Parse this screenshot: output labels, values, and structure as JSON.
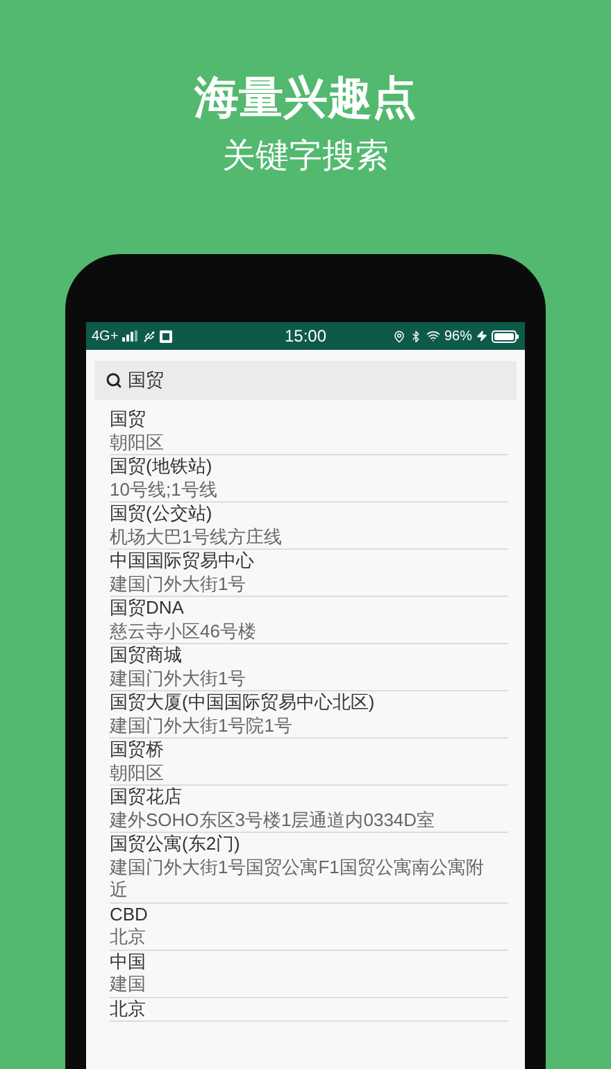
{
  "headline": {
    "title": "海量兴趣点",
    "subtitle": "关键字搜索"
  },
  "status_bar": {
    "network": "4G+",
    "time": "15:00",
    "battery": "96%"
  },
  "search": {
    "value": "国贸"
  },
  "results": [
    {
      "name": "国贸",
      "address": "朝阳区"
    },
    {
      "name": "国贸(地铁站)",
      "address": "10号线;1号线"
    },
    {
      "name": "国贸(公交站)",
      "address": "机场大巴1号线方庄线"
    },
    {
      "name": "中国国际贸易中心",
      "address": "建国门外大街1号"
    },
    {
      "name": "国贸DNA",
      "address": "慈云寺小区46号楼"
    },
    {
      "name": "国贸商城",
      "address": "建国门外大街1号"
    },
    {
      "name": "国贸大厦(中国国际贸易中心北区)",
      "address": "建国门外大街1号院1号"
    },
    {
      "name": "国贸桥",
      "address": "朝阳区"
    },
    {
      "name": "国贸花店",
      "address": "建外SOHO东区3号楼1层通道内0334D室"
    },
    {
      "name": "国贸公寓(东2门)",
      "address": "建国门外大街1号国贸公寓F1国贸公寓南公寓附近"
    },
    {
      "name": "CBD",
      "address": "北京"
    },
    {
      "name": "中国",
      "address": "建国"
    },
    {
      "name": "北京"
    }
  ]
}
